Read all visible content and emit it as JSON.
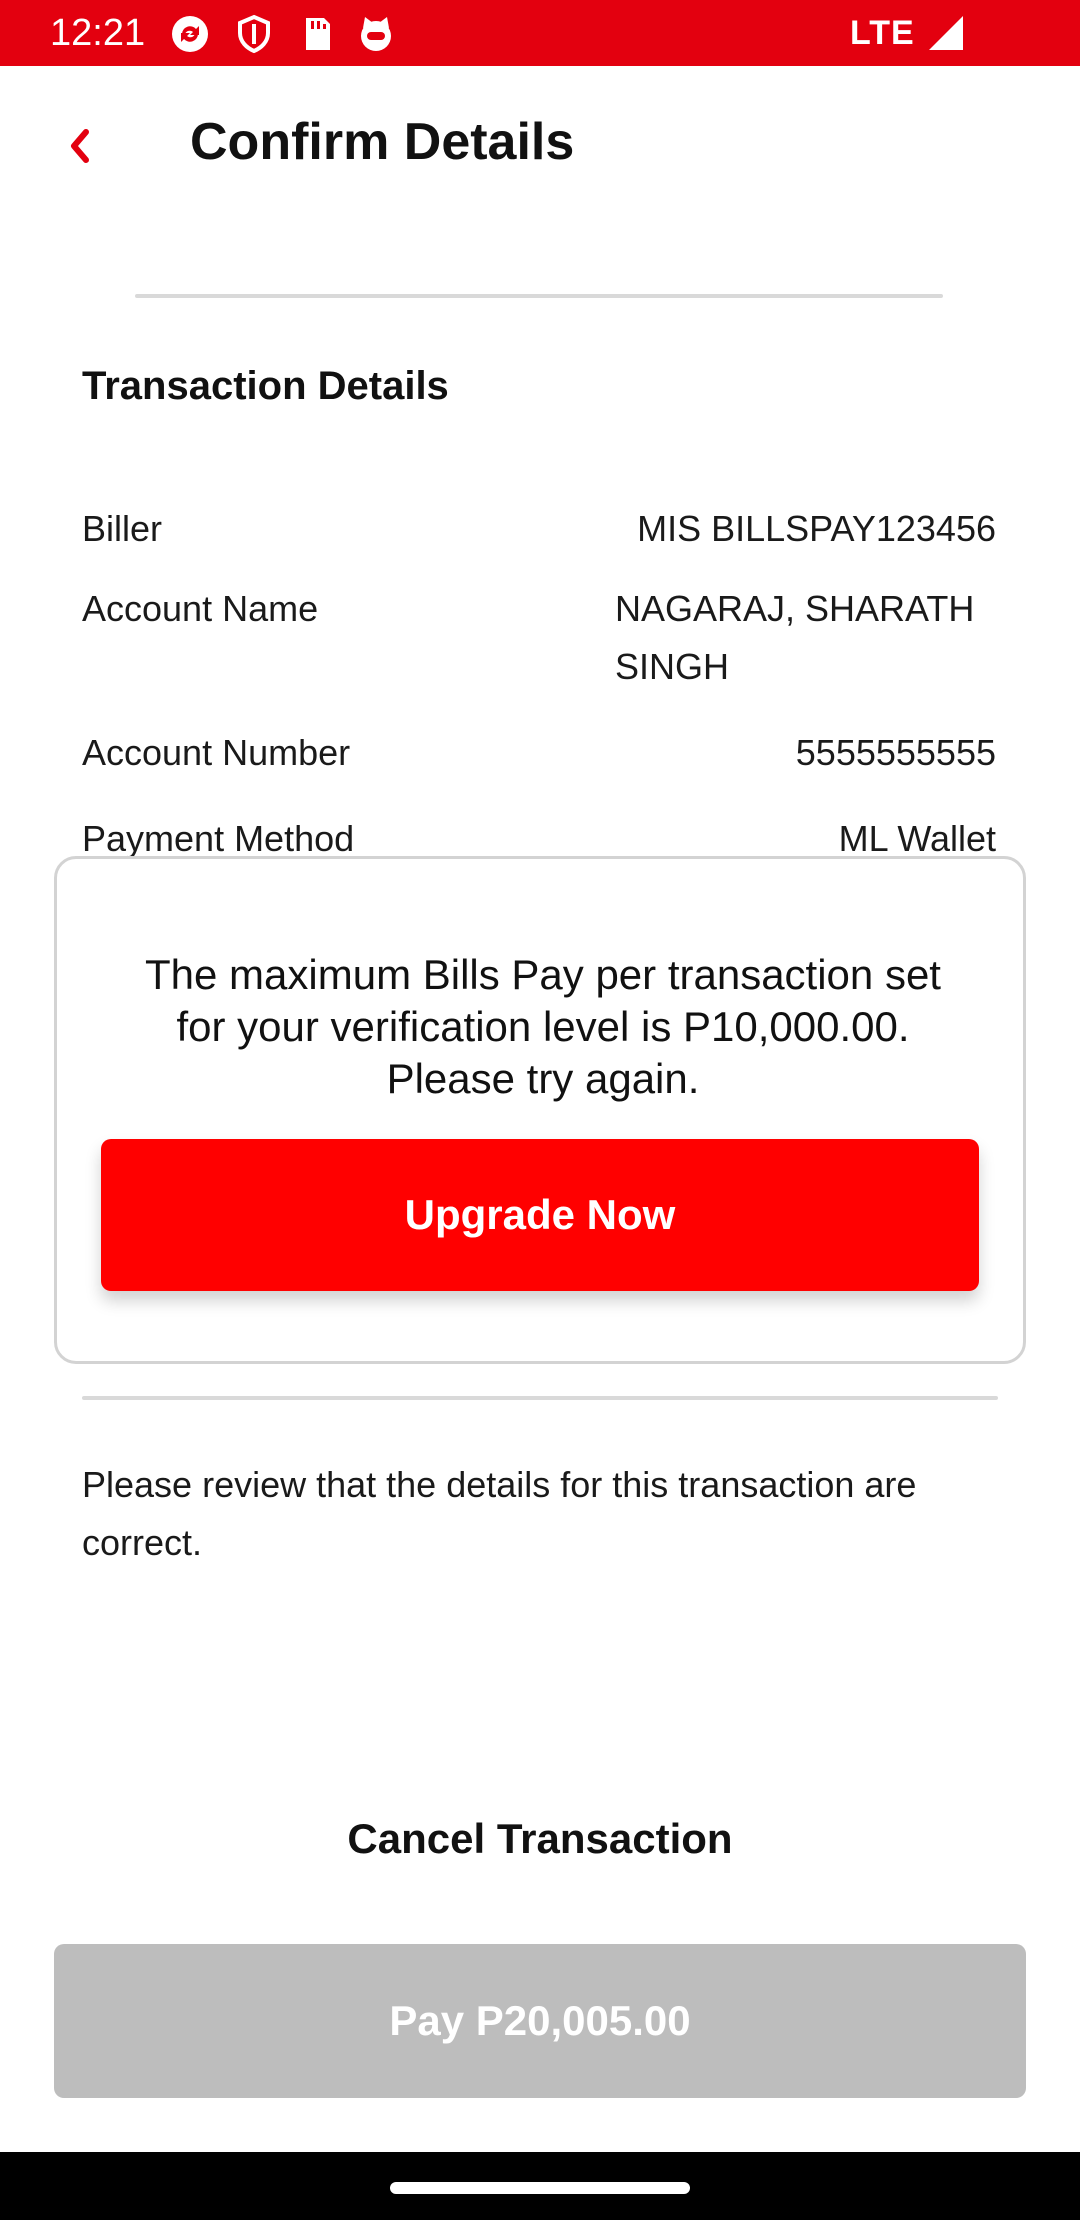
{
  "status_bar": {
    "time": "12:21",
    "network": "LTE",
    "icons": [
      "sync-icon",
      "shield-icon",
      "sd-card-icon",
      "cat-face-icon",
      "signal-icon"
    ]
  },
  "header": {
    "title": "Confirm Details",
    "back_icon": "chevron-left-icon"
  },
  "transaction_details": {
    "title": "Transaction Details",
    "rows": [
      {
        "label": "Biller",
        "value": "MIS BILLSPAY123456"
      },
      {
        "label": "Account Name",
        "value": "NAGARAJ, SHARATH SINGH"
      },
      {
        "label": "Account Number",
        "value": "5555555555"
      },
      {
        "label": "Payment Method",
        "value": "ML Wallet"
      }
    ]
  },
  "modal": {
    "message": "The maximum Bills Pay per transaction set for your verification level is P10,000.00. Please try again.",
    "button_label": "Upgrade Now"
  },
  "review_note": "Please review that the details for this transaction are correct.",
  "actions": {
    "cancel_label": "Cancel Transaction",
    "pay_label": "Pay P20,005.00"
  },
  "colors": {
    "brand_red": "#e3000f",
    "button_red": "#ff0000",
    "disabled_gray": "#bdbdbd"
  }
}
